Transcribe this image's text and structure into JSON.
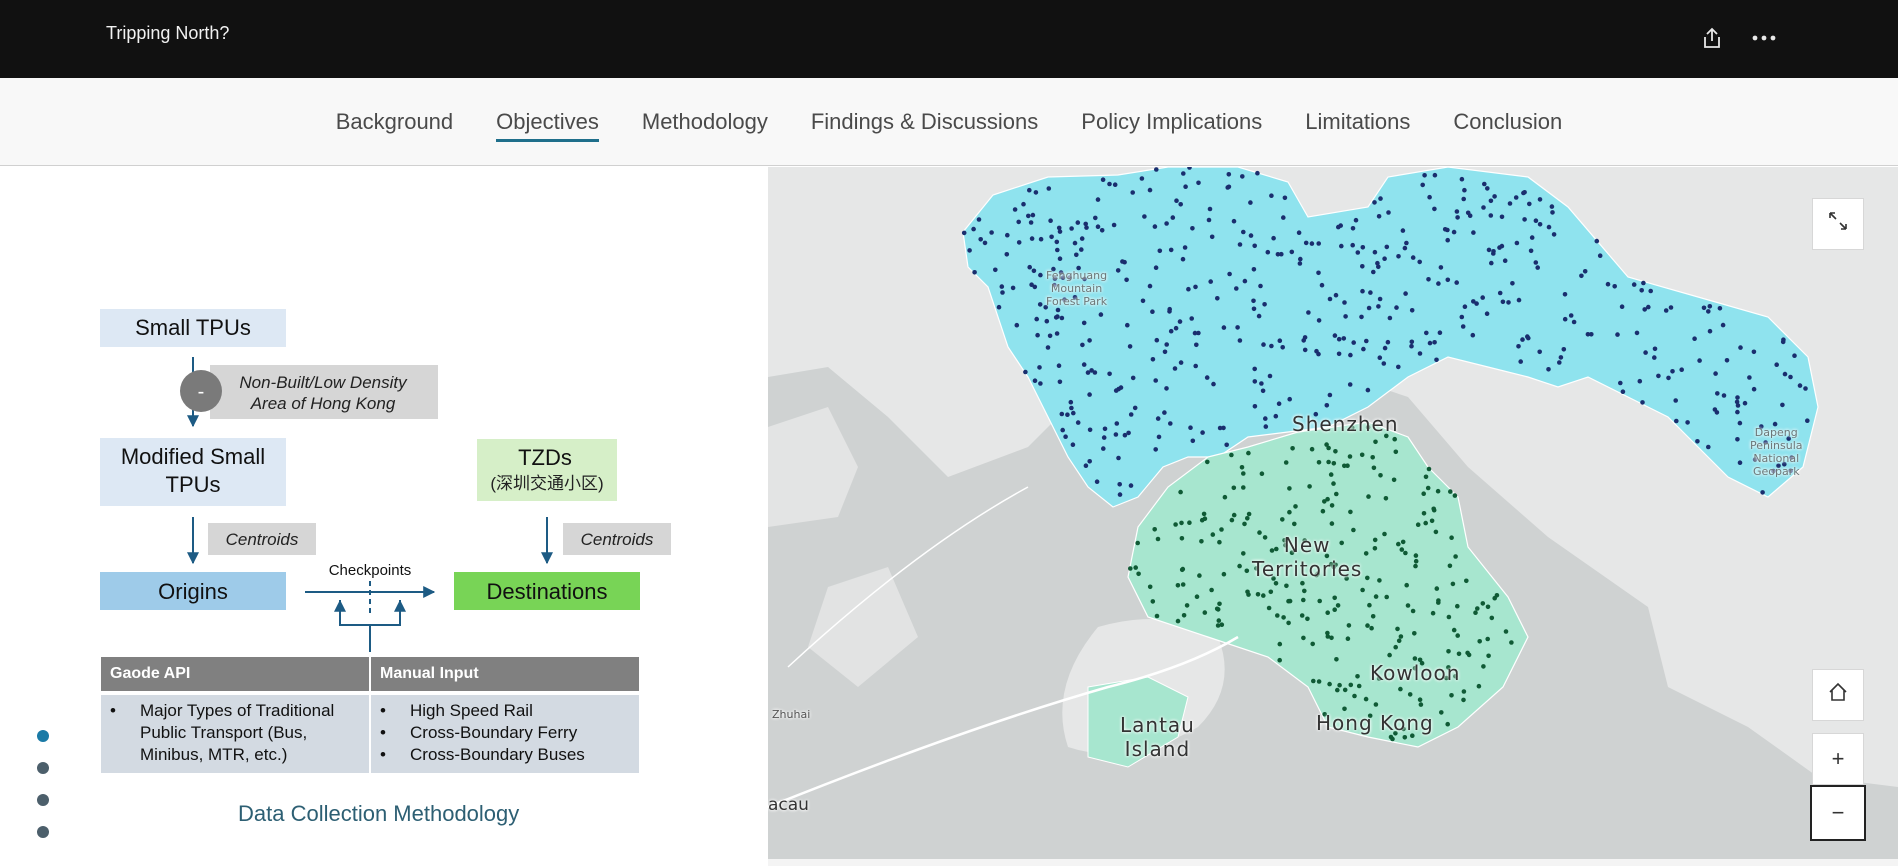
{
  "app": {
    "title": "Tripping North?"
  },
  "topbar": {
    "share_icon": "share-icon",
    "more_icon": "more-options-icon"
  },
  "nav": {
    "tabs": [
      {
        "label": "Background",
        "active": false
      },
      {
        "label": "Objectives",
        "active": true
      },
      {
        "label": "Methodology",
        "active": false
      },
      {
        "label": "Findings & Discussions",
        "active": false
      },
      {
        "label": "Policy Implications",
        "active": false
      },
      {
        "label": "Limitations",
        "active": false
      },
      {
        "label": "Conclusion",
        "active": false
      }
    ]
  },
  "diagram": {
    "small_tpus": "Small TPUs",
    "minus": "-",
    "non_built_line1": "Non-Built/Low Density",
    "non_built_line2": "Area of Hong Kong",
    "modified_line1": "Modified Small",
    "modified_line2": "TPUs",
    "tzds": "TZDs",
    "tzds_sub": "(深圳交通小区)",
    "centroids_left": "Centroids",
    "centroids_right": "Centroids",
    "checkpoints": "Checkpoints",
    "origins": "Origins",
    "destinations": "Destinations",
    "table": {
      "headers": [
        "Gaode API",
        "Manual Input"
      ],
      "left_items": [
        "Major Types of Traditional",
        "Public Transport (Bus,",
        "Minibus, MTR, etc.)"
      ],
      "right_items": [
        "High Speed Rail",
        "Cross-Boundary Ferry",
        "Cross-Boundary Buses"
      ]
    },
    "colors": {
      "light_blue": "#dde8f4",
      "blue": "#9ecbe9",
      "light_green": "#d6efc8",
      "green": "#78d456",
      "grey": "#d6d6d6",
      "header_grey": "#808080",
      "arrow": "#1d5b84"
    }
  },
  "caption": "Data Collection Methodology",
  "slide_dots": {
    "count": 4,
    "active_index": 0
  },
  "map": {
    "labels": {
      "shenzhen": "Shenzhen",
      "new_territories_1": "New",
      "new_territories_2": "Territories",
      "kowloon": "Kowloon",
      "hong_kong": "Hong Kong",
      "lantau_1": "Lantau",
      "lantau_2": "Island",
      "fenghuang_1": "Fenghuang",
      "fenghuang_2": "Mountain",
      "fenghuang_3": "Forest Park",
      "dapeng_1": "Dapeng",
      "dapeng_2": "Peninsula",
      "dapeng_3": "National",
      "dapeng_4": "Geopark",
      "zhuhai": "Zhuhai",
      "macau": "acau"
    },
    "controls": {
      "fullscreen_icon": "fullscreen-icon",
      "home_icon": "home-icon",
      "zoom_in": "+",
      "zoom_out": "−"
    },
    "colors": {
      "shenzhen_fill": "#8fe3ee",
      "hk_fill": "#a7e6cf",
      "sz_dots": "#1a2e6e",
      "hk_dots": "#0f5a35",
      "water": "#cfd2d2",
      "land": "#e6e7e7"
    }
  }
}
